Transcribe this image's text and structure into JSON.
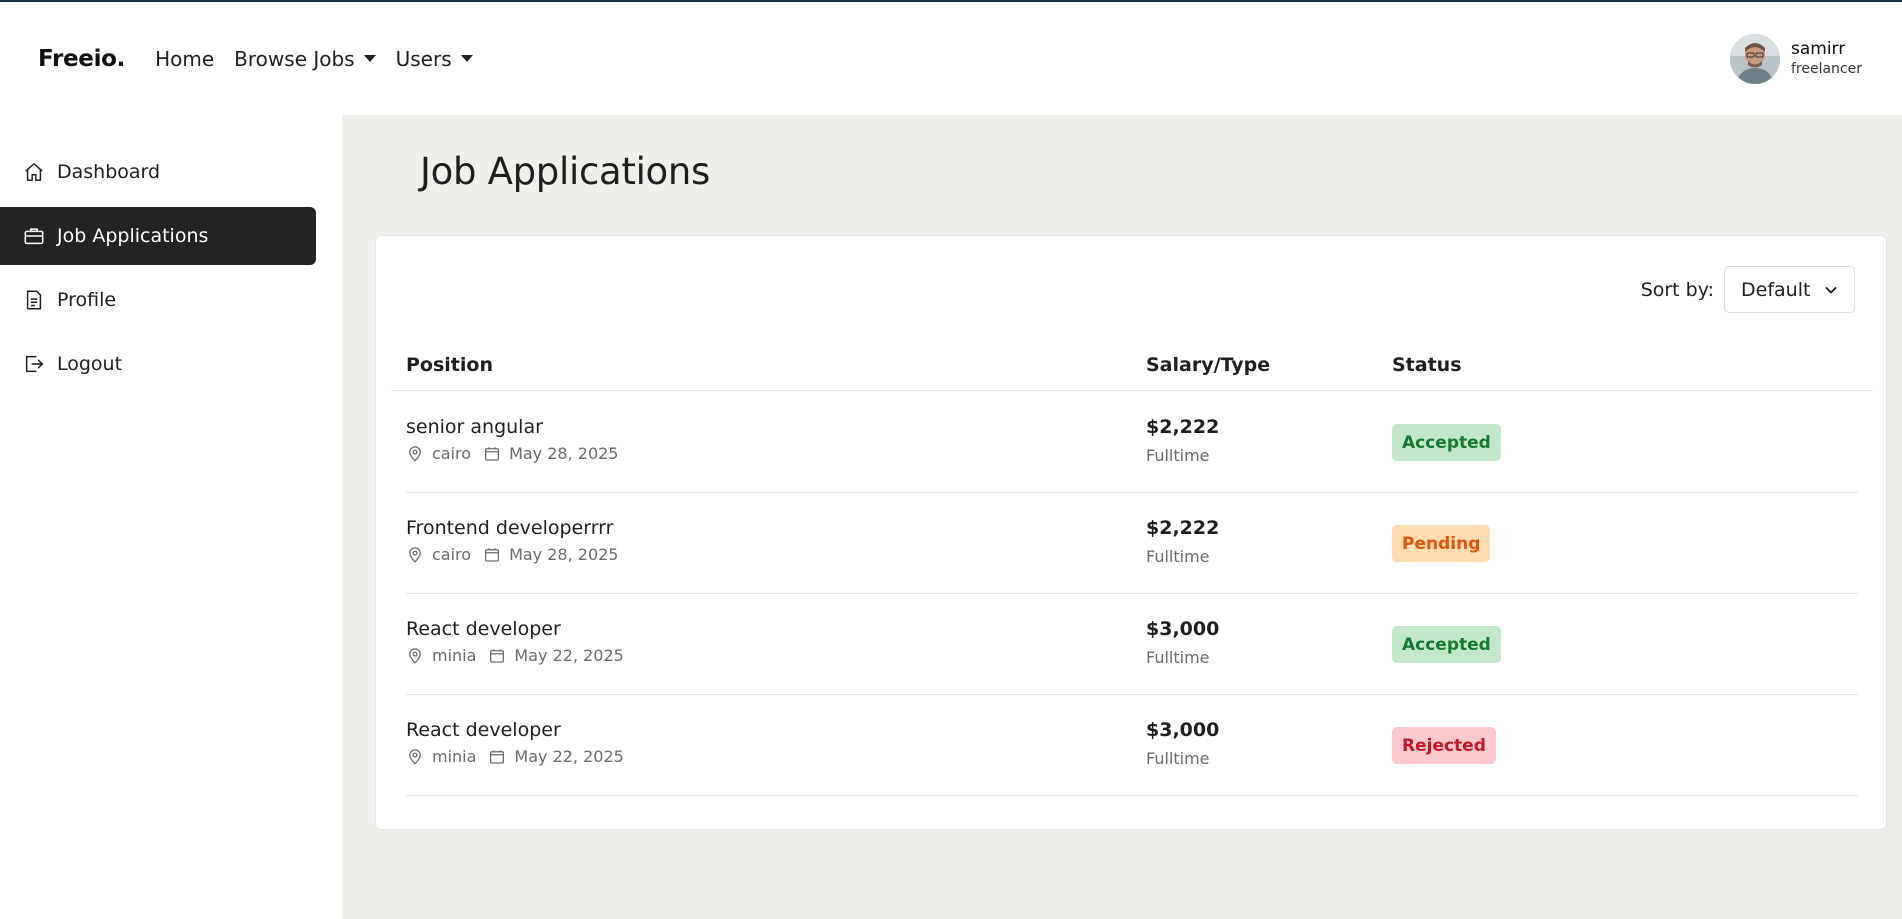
{
  "header": {
    "brand": "Freeio.",
    "nav": [
      {
        "label": "Home"
      },
      {
        "label": "Browse Jobs"
      },
      {
        "label": "Users"
      }
    ],
    "user": {
      "name": "samirr",
      "role": "freelancer"
    }
  },
  "sidebar": {
    "items": [
      {
        "label": "Dashboard",
        "icon": "home-icon"
      },
      {
        "label": "Job Applications",
        "icon": "briefcase-icon",
        "active": true
      },
      {
        "label": "Profile",
        "icon": "document-icon"
      },
      {
        "label": "Logout",
        "icon": "logout-icon"
      }
    ]
  },
  "main": {
    "title": "Job Applications",
    "sort": {
      "label": "Sort by:",
      "value": "Default"
    },
    "columns": [
      "Position",
      "Salary/Type",
      "Status"
    ],
    "rows": [
      {
        "position": "senior angular",
        "location": "cairo",
        "date": "May 28, 2025",
        "salary": "$2,222",
        "type": "Fulltime",
        "status": "Accepted"
      },
      {
        "position": "Frontend developerrrr",
        "location": "cairo",
        "date": "May 28, 2025",
        "salary": "$2,222",
        "type": "Fulltime",
        "status": "Pending"
      },
      {
        "position": "React developer",
        "location": "minia",
        "date": "May 22, 2025",
        "salary": "$3,000",
        "type": "Fulltime",
        "status": "Accepted"
      },
      {
        "position": "React developer",
        "location": "minia",
        "date": "May 22, 2025",
        "salary": "$3,000",
        "type": "Fulltime",
        "status": "Rejected"
      }
    ]
  },
  "colors": {
    "accepted_bg": "#c4e7cc",
    "accepted_fg": "#137a33",
    "pending_bg": "#ffdcb0",
    "pending_fg": "#e0550e",
    "rejected_bg": "#fcc9cf",
    "rejected_fg": "#c51528",
    "sidebar_active": "#232323",
    "main_bg": "#f0efeb"
  }
}
